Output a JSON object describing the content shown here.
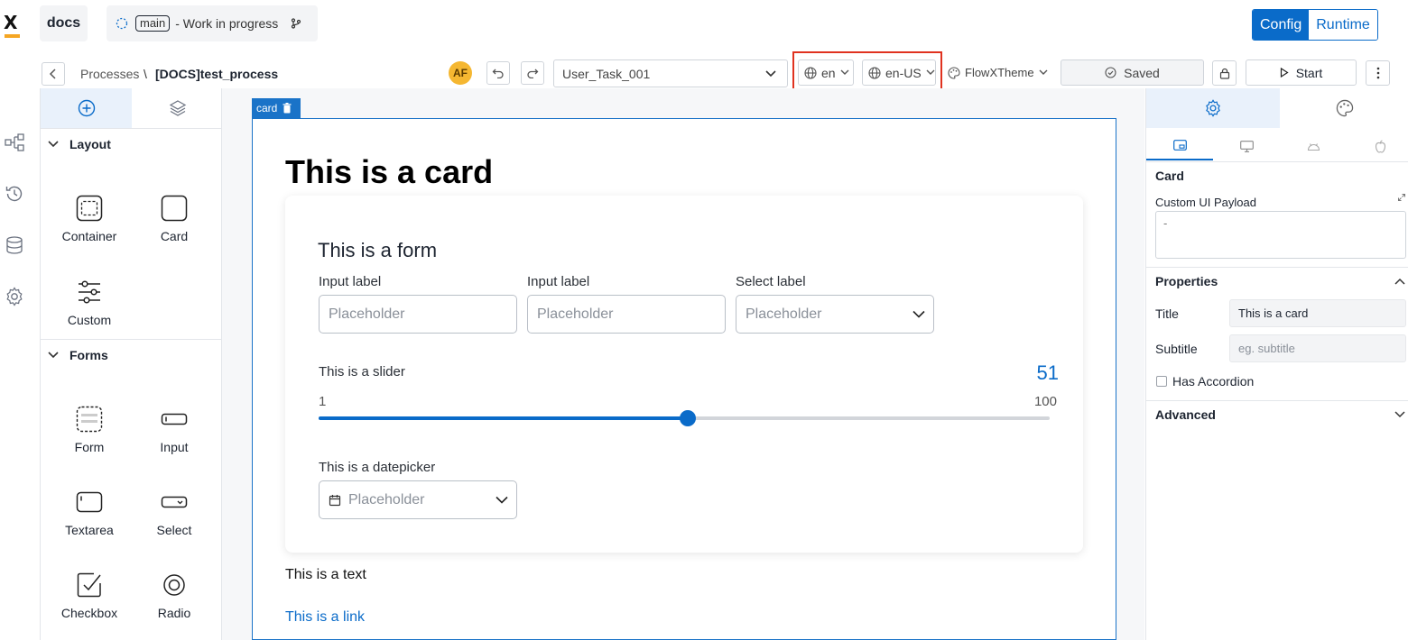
{
  "header": {
    "logo": "X",
    "app_name": "docs",
    "branch": "main",
    "branch_status": "- Work in progress",
    "mode_tabs": [
      "Config",
      "Runtime"
    ],
    "active_mode": "Config"
  },
  "toolbar": {
    "breadcrumb_parent": "Processes",
    "breadcrumb_sep": "\\",
    "breadcrumb_current": "[DOCS]test_process",
    "avatar_initials": "AF",
    "node_select": "User_Task_001",
    "language": "en",
    "locale": "en-US",
    "theme": "FlowXTheme",
    "save_status": "Saved",
    "start_label": "Start"
  },
  "left_panel": {
    "sections": [
      {
        "title": "Layout",
        "items": [
          "Container",
          "Card",
          "Custom"
        ]
      },
      {
        "title": "Forms",
        "items": [
          "Form",
          "Input",
          "Textarea",
          "Select",
          "Checkbox",
          "Radio"
        ]
      }
    ]
  },
  "canvas": {
    "selected_tag": "card",
    "card_title": "This is a card",
    "form_title": "This is a form",
    "inputs": [
      {
        "label": "Input label",
        "placeholder": "Placeholder"
      },
      {
        "label": "Input label",
        "placeholder": "Placeholder"
      }
    ],
    "select": {
      "label": "Select label",
      "placeholder": "Placeholder"
    },
    "slider": {
      "label": "This is a slider",
      "value": 51,
      "min": 1,
      "max": 100
    },
    "datepicker": {
      "label": "This is a datepicker",
      "placeholder": "Placeholder"
    },
    "text": "This is a text",
    "link": "This is a link"
  },
  "right_panel": {
    "component": "Card",
    "payload_label": "Custom UI Payload",
    "payload_value": "-",
    "properties_header": "Properties",
    "title_label": "Title",
    "title_value": "This is a card",
    "subtitle_label": "Subtitle",
    "subtitle_placeholder": "eg. subtitle",
    "accordion_label": "Has Accordion",
    "advanced_header": "Advanced"
  },
  "colors": {
    "accent": "#0a6bc9",
    "highlight_box": "#e0321f",
    "avatar": "#f5b731",
    "logo_bar": "#f5a623"
  }
}
